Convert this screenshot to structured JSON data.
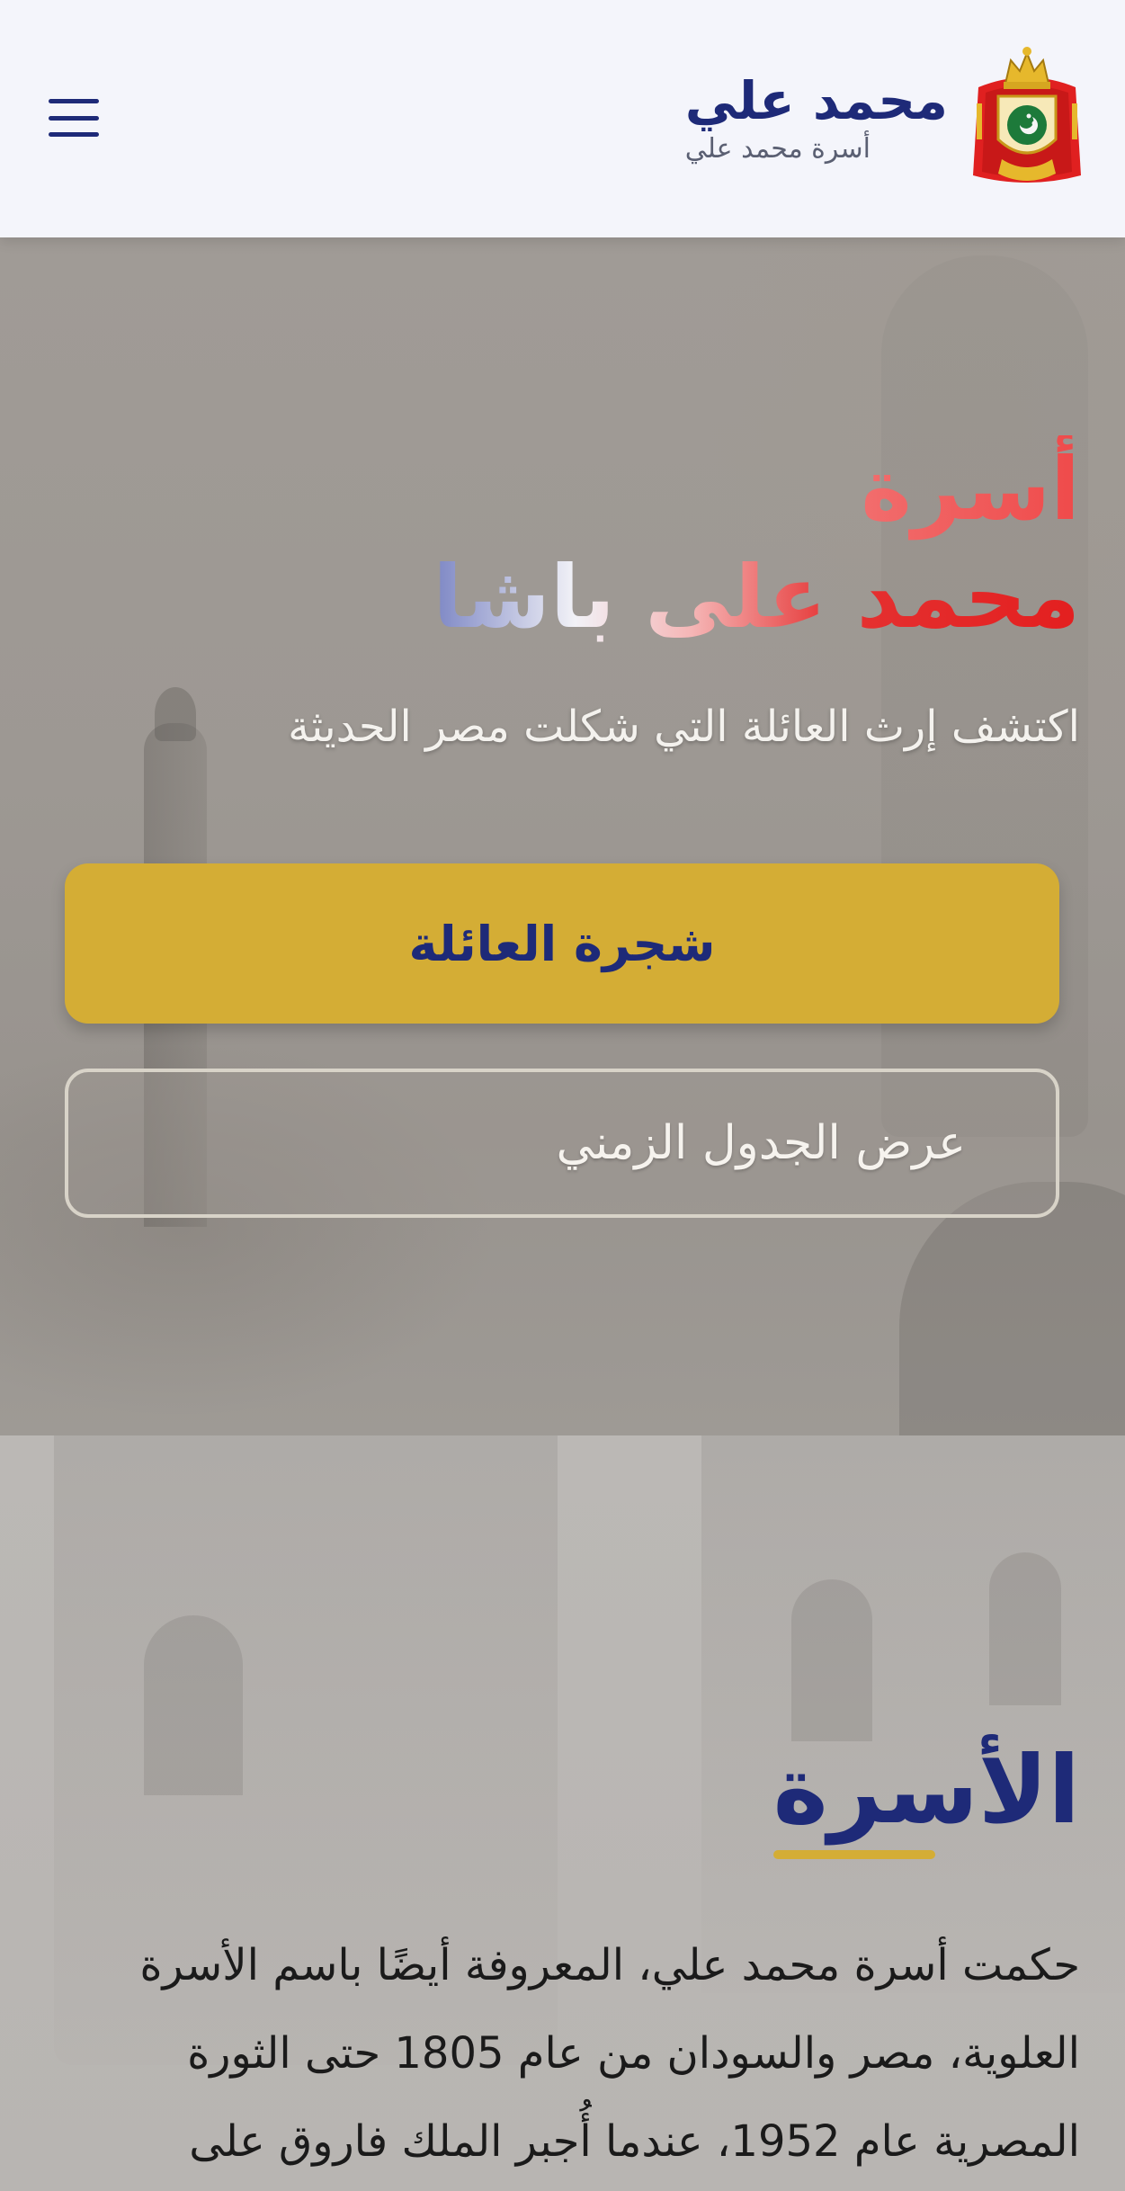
{
  "header": {
    "title": "محمد علي",
    "subtitle": "أسرة محمد علي",
    "logo_icon": "royal-coat-of-arms-icon",
    "menu_icon": "hamburger-menu-icon"
  },
  "hero": {
    "title_line1": "أسرة",
    "title_line2": "محمد على باشا",
    "subtitle": "اكتشف إرث العائلة التي شكلت مصر الحديثة",
    "primary_button": "شجرة العائلة",
    "secondary_button": "عرض الجدول الزمني"
  },
  "about": {
    "title": "الأسرة",
    "text": "حكمت أسرة محمد علي، المعروفة أيضًا باسم الأسرة العلوية، مصر والسودان من عام 1805 حتى الثورة المصرية عام 1952، عندما أُجبر الملك فاروق على"
  },
  "colors": {
    "navy": "#1e2a78",
    "gold": "#d4ad35",
    "header_bg": "#f4f5fb",
    "red": "#e31f1f"
  }
}
